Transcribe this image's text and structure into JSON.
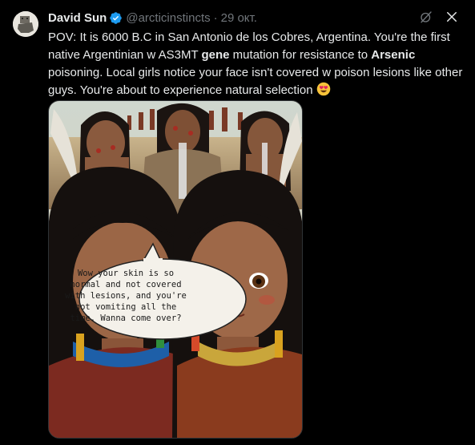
{
  "tweet": {
    "author_name": "David Sun",
    "handle": "@arcticinstincts",
    "separator": "·",
    "date": "29 окт.",
    "text_parts": {
      "p1": "POV: It is 6000 B.C in San Antonio de los Cobres, Argentina. You're the first native Argentinian w AS3MT ",
      "bold1": "gene",
      "p2": " mutation for resistance to ",
      "bold2": "Arsenic",
      "p3": " poisoning. Local girls notice your face isn't covered w poison lesions like other guys. You're about to experience natural selection"
    },
    "emoji": "heart-eyes-emoji",
    "icons": [
      "verified-badge-icon",
      "grok-icon",
      "close-icon"
    ]
  },
  "media": {
    "speech_bubble_text": "Wow your skin is so normal and not covered with lesions, and you're not vomiting all the time. Wanna come over?"
  },
  "colors": {
    "background": "#000000",
    "text": "#e7e9ea",
    "muted": "#71767b",
    "verified": "#1d9bf0"
  }
}
